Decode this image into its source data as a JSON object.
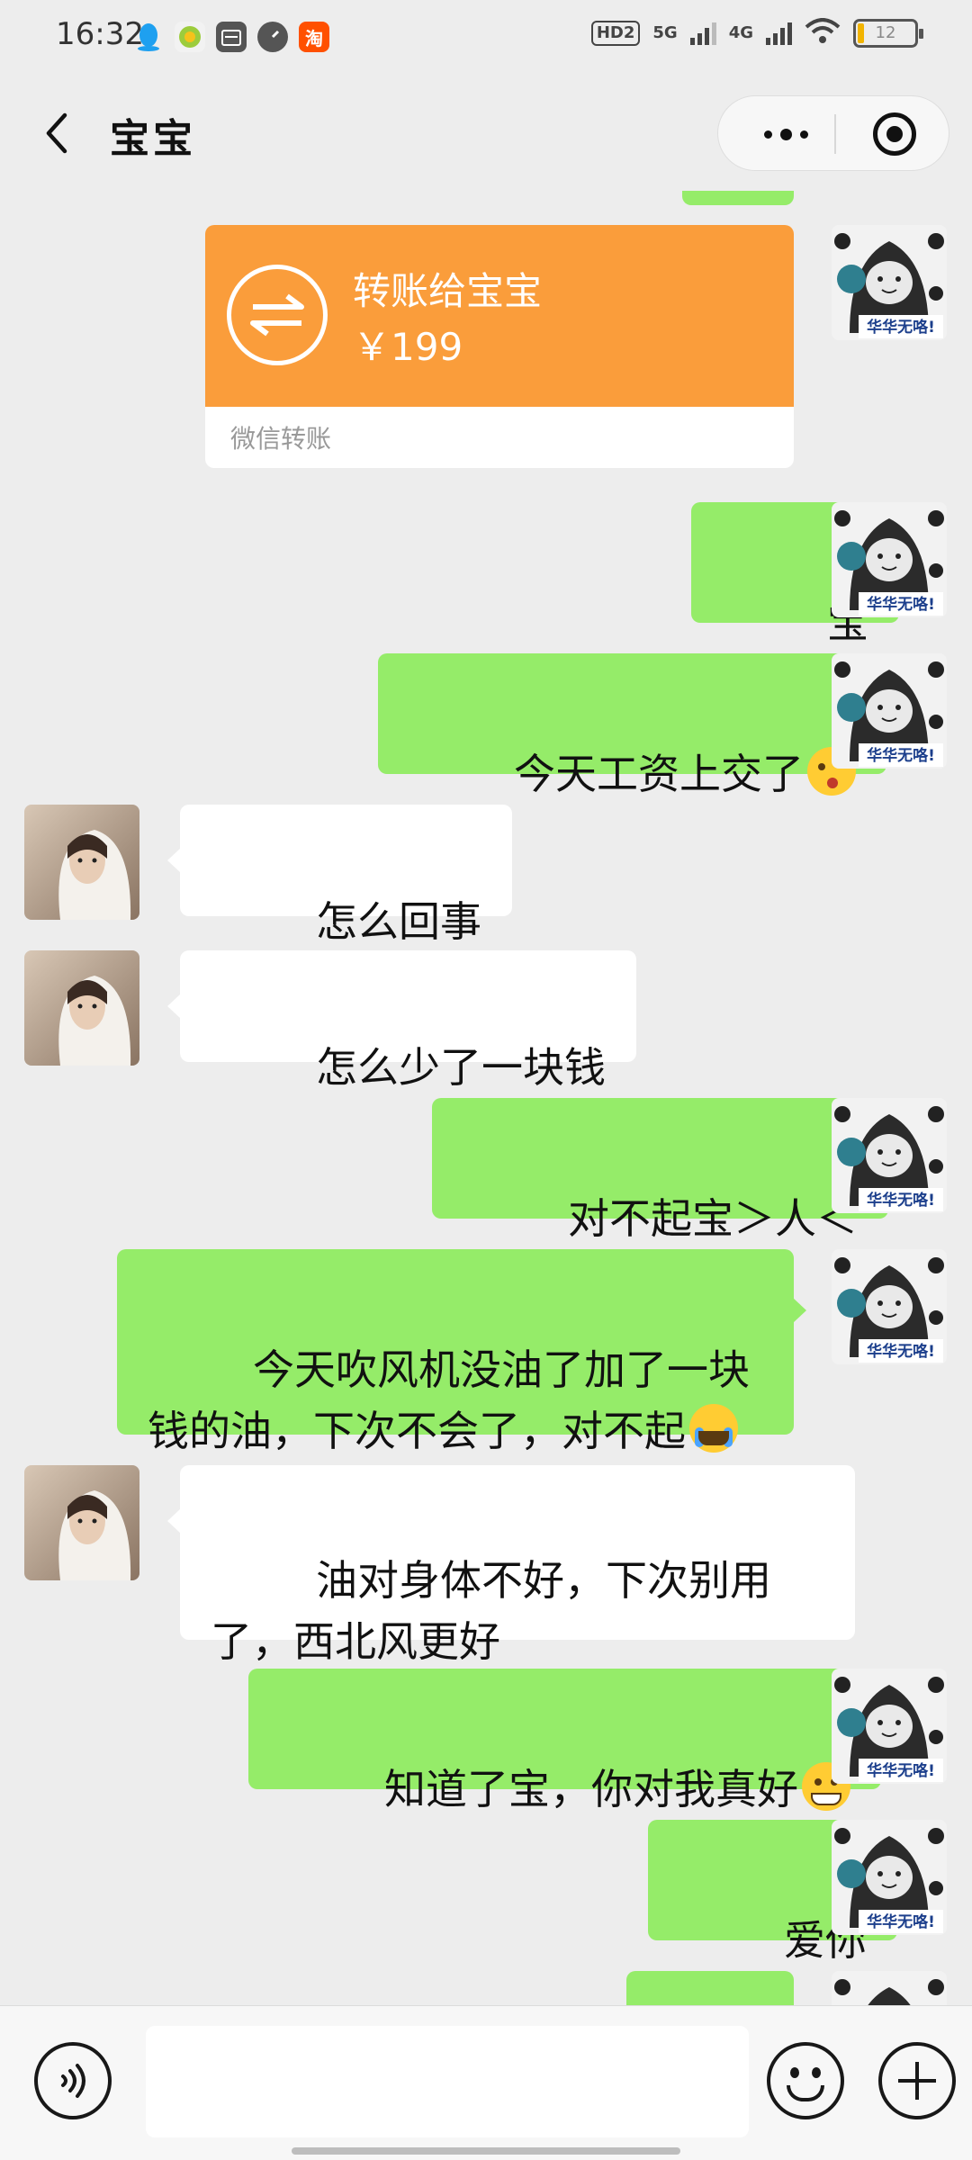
{
  "status_bar": {
    "time": "16:32",
    "left_icons": [
      "qq-icon",
      "app-icon",
      "calendar-icon",
      "speed-icon",
      "taobao-icon"
    ],
    "taobao_label": "淘",
    "hd_label": "HD2",
    "net1": "5G",
    "net2": "4G",
    "battery": "12",
    "battery_level": 0.12
  },
  "header": {
    "title": "宝宝"
  },
  "messages": {
    "transfer": {
      "title": "转账给宝宝",
      "amount": "￥199",
      "footer": "微信转账"
    },
    "m1": "宝",
    "m2": "今天工资上交了",
    "m3": "怎么回事",
    "m4": "怎么少了一块钱",
    "m5": "对不起宝＞人＜",
    "m6": "今天吹风机没油了加了一块钱的油，下次不会了，对不起",
    "m7": "油对身体不好，下次别用了，西北风更好",
    "m8": "知道了宝，你对我真好",
    "m9": "爱你"
  },
  "avatar_caption": "华华无咯!",
  "input": {
    "placeholder": ""
  },
  "colors": {
    "outgoing_bubble": "#95ec69",
    "incoming_bubble": "#ffffff",
    "transfer_orange": "#fa9d3b",
    "background": "#ededed"
  }
}
